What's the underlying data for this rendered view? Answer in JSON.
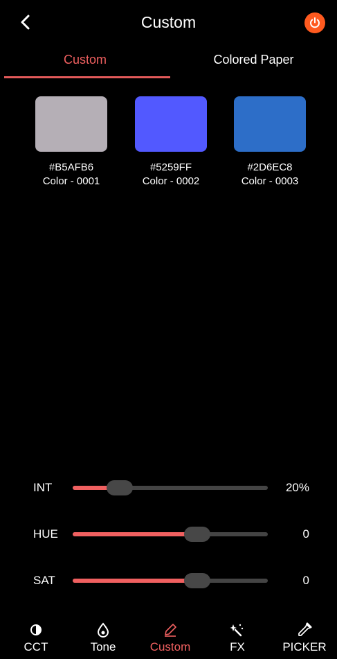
{
  "header": {
    "title": "Custom",
    "back_icon": "chevron-left-icon",
    "power_icon": "power-icon",
    "power_color": "#ff5a1f"
  },
  "tabs": [
    {
      "label": "Custom",
      "active": true
    },
    {
      "label": "Colored Paper",
      "active": false
    }
  ],
  "accent_color": "#f06060",
  "swatches": [
    {
      "hex": "#B5AFB6",
      "name": "Color - 0001",
      "color": "#B5AFB6"
    },
    {
      "hex": "#5259FF",
      "name": "Color - 0002",
      "color": "#5259FF"
    },
    {
      "hex": "#2D6EC8",
      "name": "Color - 0003",
      "color": "#2D6EC8"
    }
  ],
  "sliders": [
    {
      "label": "INT",
      "value": "20%",
      "fill": 0.24
    },
    {
      "label": "HUE",
      "value": "0",
      "fill": 0.64
    },
    {
      "label": "SAT",
      "value": "0",
      "fill": 0.64
    }
  ],
  "bottom_nav": [
    {
      "label": "CCT",
      "icon": "contrast-icon",
      "active": false
    },
    {
      "label": "Tone",
      "icon": "drop-icon",
      "active": false
    },
    {
      "label": "Custom",
      "icon": "pencil-icon",
      "active": true
    },
    {
      "label": "FX",
      "icon": "magic-wand-icon",
      "active": false
    },
    {
      "label": "PICKER",
      "icon": "eyedropper-icon",
      "active": false
    }
  ]
}
